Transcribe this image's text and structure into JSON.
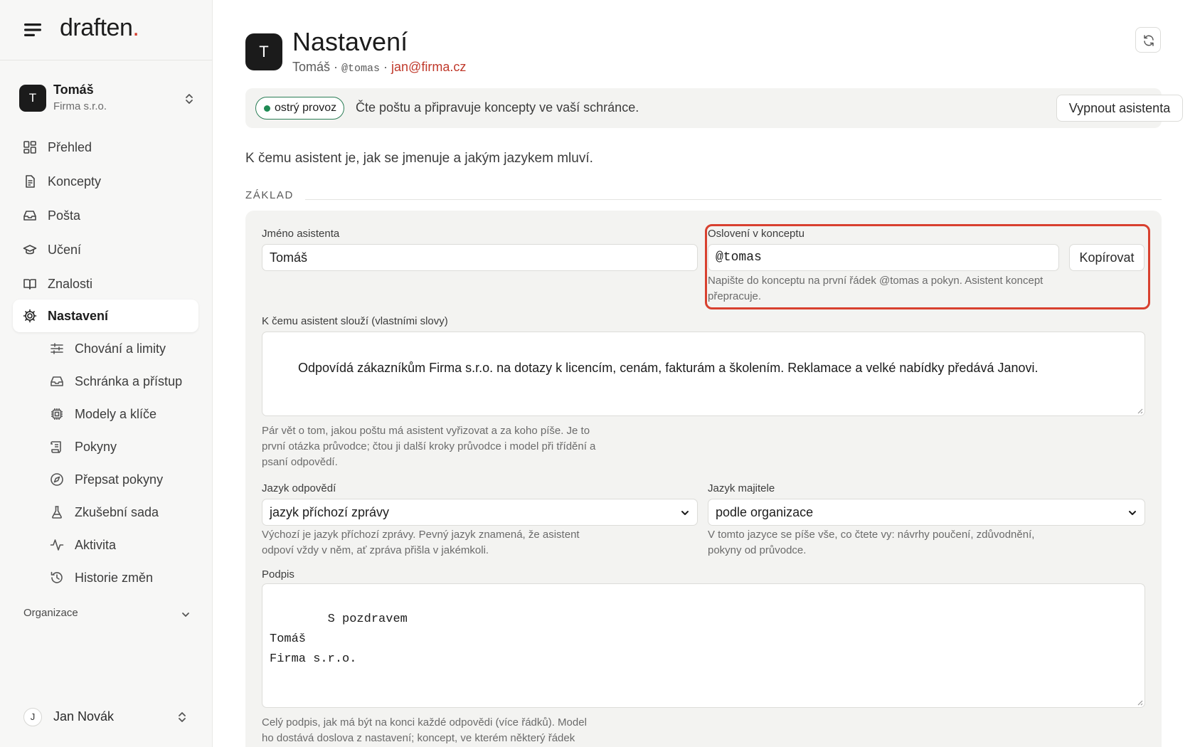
{
  "brand": {
    "name": "draften",
    "dot": "."
  },
  "workspace": {
    "avatar": "T",
    "name": "Tomáš",
    "org": "Firma s.r.o."
  },
  "nav": {
    "items": [
      {
        "label": "Přehled",
        "icon": "dashboard-icon"
      },
      {
        "label": "Koncepty",
        "icon": "document-icon"
      },
      {
        "label": "Pošta",
        "icon": "inbox-icon"
      },
      {
        "label": "Učení",
        "icon": "graduation-cap-icon"
      },
      {
        "label": "Znalosti",
        "icon": "book-icon"
      },
      {
        "label": "Nastavení",
        "icon": "gear-icon",
        "active": true
      }
    ],
    "sub_items": [
      {
        "label": "Chování a limity",
        "icon": "sliders-icon"
      },
      {
        "label": "Schránka a přístup",
        "icon": "inbox-icon"
      },
      {
        "label": "Modely a klíče",
        "icon": "chip-icon"
      },
      {
        "label": "Pokyny",
        "icon": "scroll-icon"
      },
      {
        "label": "Přepsat pokyny",
        "icon": "compass-icon"
      },
      {
        "label": "Zkušební sada",
        "icon": "flask-icon"
      },
      {
        "label": "Aktivita",
        "icon": "activity-icon"
      },
      {
        "label": "Historie změn",
        "icon": "history-icon"
      }
    ],
    "org_section": "Organizace"
  },
  "user": {
    "avatar": "J",
    "name": "Jan Novák"
  },
  "header": {
    "avatar": "T",
    "title": "Nastavení",
    "name": "Tomáš",
    "sep1": " · ",
    "handle": "@tomas",
    "sep2": " · ",
    "email": "jan@firma.cz"
  },
  "status": {
    "pill": "ostrý provoz",
    "text": "Čte poštu a připravuje koncepty ve vaší schránce.",
    "button": "Vypnout asistenta",
    "color": "#1f8a54"
  },
  "intro": "K čemu asistent je, jak se jmenuje a jakým jazykem mluví.",
  "section": "ZÁKLAD",
  "form": {
    "name_label": "Jméno asistenta",
    "name_value": "Tomáš",
    "greeting_label": "Oslovení v konceptu",
    "greeting_value": "@tomas",
    "copy_button": "Kopírovat",
    "greeting_help_1": "Napište do konceptu na první řádek @tomas a pokyn. Asistent koncept",
    "greeting_help_2": "přepracuje.",
    "purpose_label": "K čemu asistent slouží (vlastními slovy)",
    "purpose_value": "Odpovídá zákazníkům Firma s.r.o. na dotazy k licencím, cenám, fakturám a školením. Reklamace a velké nabídky předává Janovi.",
    "purpose_help_1": "Pár vět o tom, jakou poštu má asistent vyřizovat a za koho píše. Je to",
    "purpose_help_2": "první otázka průvodce; čtou ji další kroky průvodce i model při třídění a",
    "purpose_help_3": "psaní odpovědí.",
    "reply_lang_label": "Jazyk odpovědí",
    "reply_lang_value": "jazyk příchozí zprávy",
    "reply_lang_help_1": "Výchozí je jazyk příchozí zprávy. Pevný jazyk znamená, že asistent",
    "reply_lang_help_2": "odpoví vždy v něm, ať zpráva přišla v jakémkoli.",
    "owner_lang_label": "Jazyk majitele",
    "owner_lang_value": "podle organizace",
    "owner_lang_help_1": "V tomto jazyce se píše vše, co čtete vy: návrhy poučení, zdůvodnění,",
    "owner_lang_help_2": "pokyny od průvodce.",
    "signature_label": "Podpis",
    "signature_value": "S pozdravem\nTomáš\nFirma s.r.o.",
    "signature_help_1": "Celý podpis, jak má být na konci každé odpovědi (více řádků). Model",
    "signature_help_2": "ho dostává doslova z nastavení; koncept, ve kterém některý řádek"
  },
  "accent": "#d8402f"
}
